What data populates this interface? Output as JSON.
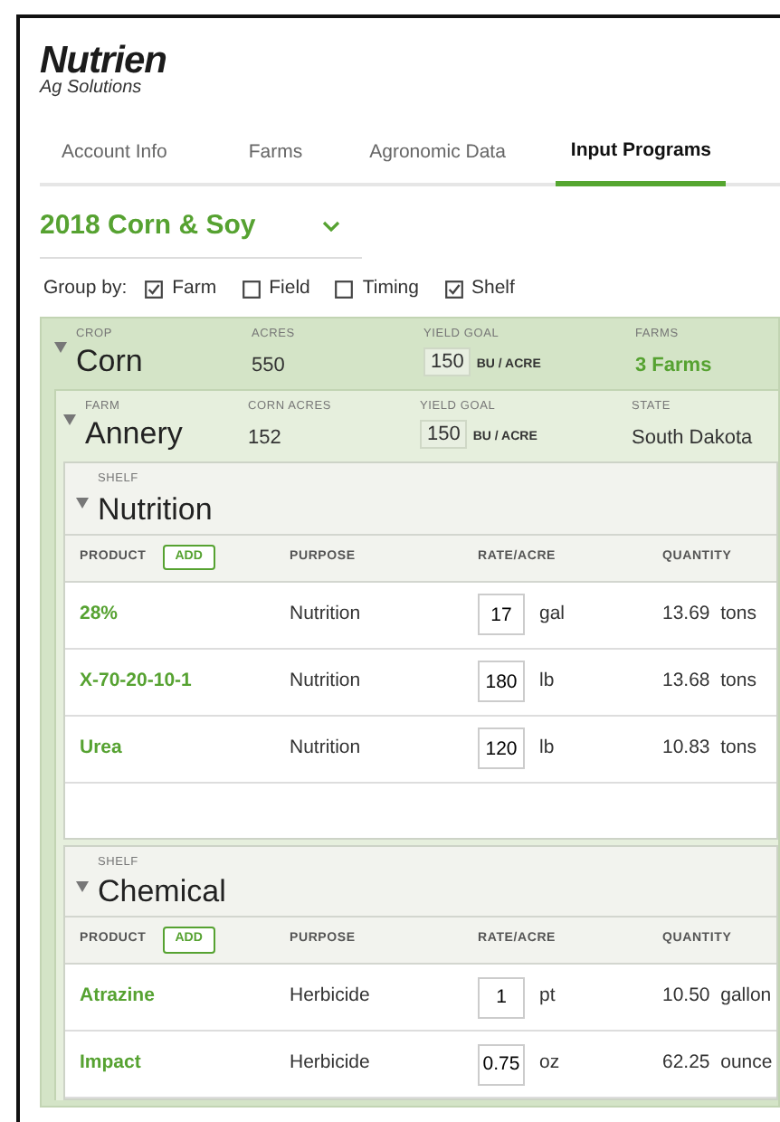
{
  "logo": {
    "name": "Nutrien",
    "tagline": "Ag Solutions"
  },
  "tabs": [
    {
      "label": "Account Info",
      "selected": false
    },
    {
      "label": "Farms",
      "selected": false
    },
    {
      "label": "Agronomic Data",
      "selected": false
    },
    {
      "label": "Input Programs",
      "selected": true
    }
  ],
  "program_select": {
    "value": "2018 Corn & Soy"
  },
  "group_by": {
    "label": "Group by:",
    "options": [
      {
        "label": "Farm",
        "checked": true
      },
      {
        "label": "Field",
        "checked": false
      },
      {
        "label": "Timing",
        "checked": false
      },
      {
        "label": "Shelf",
        "checked": true
      }
    ]
  },
  "crop": {
    "expanded": true,
    "fields": [
      {
        "label": "CROP",
        "value": "Corn",
        "kind": "title"
      },
      {
        "label": "ACRES",
        "value": "550",
        "kind": "text"
      },
      {
        "label": "YIELD GOAL",
        "value": "150",
        "unit": "BU / ACRE",
        "kind": "input"
      },
      {
        "label": "FARMS",
        "value": "3 Farms",
        "kind": "link"
      }
    ],
    "farm": {
      "expanded": true,
      "fields": [
        {
          "label": "FARM",
          "value": "Annery",
          "kind": "title"
        },
        {
          "label": "CORN ACRES",
          "value": "152",
          "kind": "text"
        },
        {
          "label": "YIELD GOAL",
          "value": "150",
          "unit": "BU / ACRE",
          "kind": "input"
        },
        {
          "label": "STATE",
          "value": "South Dakota",
          "kind": "text"
        }
      ],
      "shelves": [
        {
          "label": "SHELF",
          "title": "Nutrition",
          "expanded": true,
          "columns": [
            "PRODUCT",
            "PURPOSE",
            "RATE/ACRE",
            "QUANTITY"
          ],
          "add_button": "ADD",
          "rows": [
            {
              "product": "28%",
              "purpose": "Nutrition",
              "rate": "17",
              "unit": "gal",
              "quantity": "13.69  tons"
            },
            {
              "product": "X-70-20-10-1",
              "purpose": "Nutrition",
              "rate": "180",
              "unit": "lb",
              "quantity": "13.68  tons"
            },
            {
              "product": "Urea",
              "purpose": "Nutrition",
              "rate": "120",
              "unit": "lb",
              "quantity": "10.83  tons"
            }
          ]
        },
        {
          "label": "SHELF",
          "title": "Chemical",
          "expanded": true,
          "columns": [
            "PRODUCT",
            "PURPOSE",
            "RATE/ACRE",
            "QUANTITY"
          ],
          "add_button": "ADD",
          "rows": [
            {
              "product": "Atrazine",
              "purpose": "Herbicide",
              "rate": "1",
              "unit": "pt",
              "quantity": "10.50  gallon"
            },
            {
              "product": "Impact",
              "purpose": "Herbicide",
              "rate": "0.75",
              "unit": "oz",
              "quantity": "62.25  ounce"
            }
          ]
        }
      ]
    }
  }
}
